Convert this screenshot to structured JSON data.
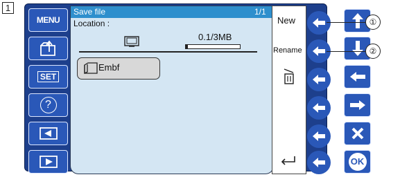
{
  "step_number": "1",
  "left_panel": {
    "menu_label": "MENU",
    "set_label": "SET",
    "help_label": "?"
  },
  "screen": {
    "title": "Save file",
    "page_indicator": "1/1",
    "location_label": "Location :",
    "memory_usage": "0.1/3MB",
    "memory_fraction": 0.033,
    "folder_name": "Embf"
  },
  "softkeys": {
    "new_label": "New",
    "rename_label": "Rename"
  },
  "right_panel": {
    "ok_label": "OK"
  },
  "callouts": [
    "①",
    "②"
  ],
  "colors": {
    "panel": "#1d3f8c",
    "button": "#2a58b8",
    "screen_bg": "#d4e6f3",
    "titlebar": "#2e8fcd"
  }
}
